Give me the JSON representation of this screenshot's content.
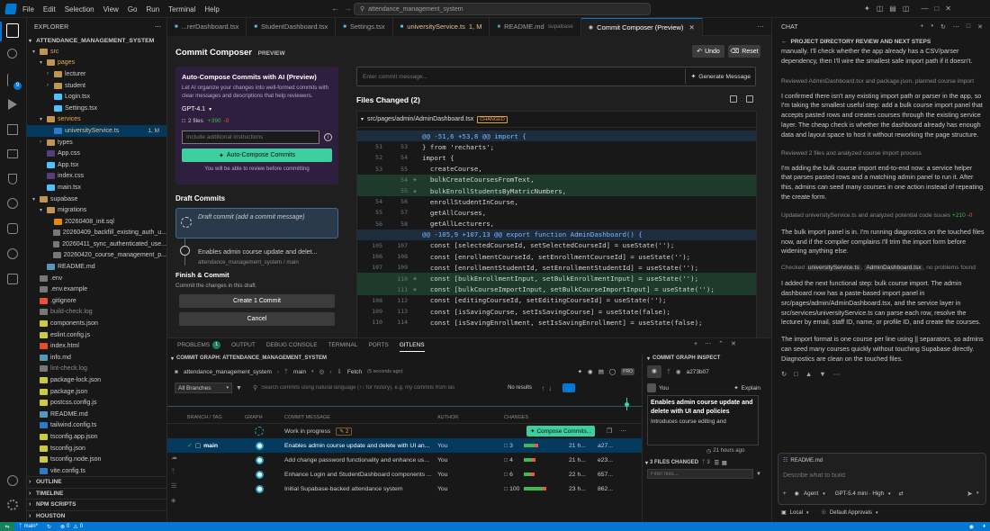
{
  "titlebar": {
    "menus": [
      "File",
      "Edit",
      "Selection",
      "View",
      "Go",
      "Run",
      "Terminal",
      "Help"
    ],
    "search_text": "attendance_management_system"
  },
  "activity": {
    "icons": [
      "files-icon",
      "search-icon",
      "source-control-icon",
      "run-debug-icon",
      "extensions-icon",
      "remote-icon",
      "testing-icon",
      "gitlens-icon",
      "github-icon",
      "timeline-icon",
      "account-icon",
      "settings-icon"
    ],
    "badge": "9"
  },
  "explorer": {
    "header": "EXPLORER",
    "root": "ATTENDANCE_MANAGEMENT_SYSTEM",
    "items": [
      {
        "label": "src",
        "depth": 0,
        "type": "folder-open",
        "color": "#e8ab53"
      },
      {
        "label": "pages",
        "depth": 1,
        "type": "folder-open",
        "color": "#e8ab53"
      },
      {
        "label": "lecturer",
        "depth": 2,
        "type": "folder",
        "color": "#cccccc"
      },
      {
        "label": "student",
        "depth": 2,
        "type": "folder",
        "color": "#cccccc"
      },
      {
        "label": "Login.tsx",
        "depth": 2,
        "type": "file",
        "color": "#cccccc"
      },
      {
        "label": "Settings.tsx",
        "depth": 2,
        "type": "file",
        "color": "#cccccc"
      },
      {
        "label": "services",
        "depth": 1,
        "type": "folder-open",
        "color": "#e8ab53"
      },
      {
        "label": "universityService.ts",
        "depth": 2,
        "type": "file",
        "color": "#e2c08d",
        "badge": "1, M"
      },
      {
        "label": "types",
        "depth": 1,
        "type": "folder",
        "color": "#cccccc"
      },
      {
        "label": "App.css",
        "depth": 1,
        "type": "file",
        "color": "#cccccc"
      },
      {
        "label": "App.tsx",
        "depth": 1,
        "type": "file",
        "color": "#cccccc"
      },
      {
        "label": "index.css",
        "depth": 1,
        "type": "file",
        "color": "#cccccc"
      },
      {
        "label": "main.tsx",
        "depth": 1,
        "type": "file",
        "color": "#cccccc"
      },
      {
        "label": "supabase",
        "depth": 0,
        "type": "folder-open",
        "color": "#cccccc"
      },
      {
        "label": "migrations",
        "depth": 1,
        "type": "folder-open",
        "color": "#cccccc"
      },
      {
        "label": "20260408_init.sql",
        "depth": 2,
        "type": "file",
        "color": "#cccccc"
      },
      {
        "label": "20260409_backfill_existing_auth_u...",
        "depth": 2,
        "type": "file",
        "color": "#cccccc"
      },
      {
        "label": "20260411_sync_authenticated_use...",
        "depth": 2,
        "type": "file",
        "color": "#cccccc"
      },
      {
        "label": "20260420_course_management_p...",
        "depth": 2,
        "type": "file",
        "color": "#cccccc"
      },
      {
        "label": "README.md",
        "depth": 1,
        "type": "file",
        "color": "#cccccc"
      },
      {
        "label": ".env",
        "depth": 0,
        "type": "file",
        "color": "#cccccc"
      },
      {
        "label": ".env.example",
        "depth": 0,
        "type": "file",
        "color": "#cccccc"
      },
      {
        "label": ".gitignore",
        "depth": 0,
        "type": "file",
        "color": "#cccccc"
      },
      {
        "label": "build-check.log",
        "depth": 0,
        "type": "file",
        "color": "#8b8b8b"
      },
      {
        "label": "components.json",
        "depth": 0,
        "type": "file",
        "color": "#cccccc"
      },
      {
        "label": "eslint.config.js",
        "depth": 0,
        "type": "file",
        "color": "#cccccc"
      },
      {
        "label": "index.html",
        "depth": 0,
        "type": "file",
        "color": "#cccccc"
      },
      {
        "label": "info.md",
        "depth": 0,
        "type": "file",
        "color": "#cccccc"
      },
      {
        "label": "lint-check.log",
        "depth": 0,
        "type": "file",
        "color": "#8b8b8b"
      },
      {
        "label": "package-lock.json",
        "depth": 0,
        "type": "file",
        "color": "#cccccc"
      },
      {
        "label": "package.json",
        "depth": 0,
        "type": "file",
        "color": "#cccccc"
      },
      {
        "label": "postcss.config.js",
        "depth": 0,
        "type": "file",
        "color": "#cccccc"
      },
      {
        "label": "README.md",
        "depth": 0,
        "type": "file",
        "color": "#cccccc"
      },
      {
        "label": "tailwind.config.ts",
        "depth": 0,
        "type": "file",
        "color": "#cccccc"
      },
      {
        "label": "tsconfig.app.json",
        "depth": 0,
        "type": "file",
        "color": "#cccccc"
      },
      {
        "label": "tsconfig.json",
        "depth": 0,
        "type": "file",
        "color": "#cccccc"
      },
      {
        "label": "tsconfig.node.json",
        "depth": 0,
        "type": "file",
        "color": "#cccccc"
      },
      {
        "label": "vite.config.ts",
        "depth": 0,
        "type": "file",
        "color": "#cccccc"
      }
    ],
    "sections": [
      "OUTLINE",
      "TIMELINE",
      "NPM SCRIPTS",
      "HOUSTON"
    ]
  },
  "tabs": [
    {
      "label": "...rerDashboard.tsx",
      "active": false
    },
    {
      "label": "StudentDashboard.tsx",
      "active": false
    },
    {
      "label": "Settings.tsx",
      "active": false
    },
    {
      "label": "universityService.ts",
      "active": false,
      "badge": "1, M"
    },
    {
      "label": "README.md",
      "active": false,
      "suffix": "supabase"
    },
    {
      "label": "Commit Composer (Preview)",
      "active": true
    }
  ],
  "composer": {
    "title": "Commit Composer",
    "preview": "PREVIEW",
    "undo": "Undo",
    "reset": "Reset",
    "ai_title": "Auto-Compose Commits with AI (Preview)",
    "ai_desc": "Let AI organize your changes into well-formed commits with clear messages and descriptions that help reviewers.",
    "model": "GPT-4.1",
    "stats": "2 files",
    "added": "+390",
    "removed": "-0",
    "instructions_placeholder": "Include additional instructions",
    "auto_button": "Auto-Compose Commits",
    "review_note": "You will be able to review before committing",
    "draft_title": "Draft Commits",
    "draft_commit": "Draft commit (add a commit message)",
    "commit2_title": "Enables admin course update and delet...",
    "commit2_sub": "attendance_management_system / main",
    "finish_title": "Finish & Commit",
    "finish_desc": "Commit the changes in this draft.",
    "create_button": "Create 1 Commit",
    "cancel_button": "Cancel",
    "message_placeholder": "Enter commit message...",
    "generate_button": "Generate Message",
    "files_changed": "Files Changed (2)",
    "file_path": "src/pages/admin/AdminDashboard.tsx",
    "file_status": "CHANGED"
  },
  "diff": [
    {
      "type": "hunk",
      "old": "",
      "new": "",
      "text": "@@ -51,6 +53,8 @@ import {"
    },
    {
      "type": "ctx",
      "old": "51",
      "new": "53",
      "text": "} from 'recharts';"
    },
    {
      "type": "ctx",
      "old": "52",
      "new": "54",
      "text": "import {"
    },
    {
      "type": "ctx",
      "old": "53",
      "new": "55",
      "text": "  createCourse,"
    },
    {
      "type": "add",
      "old": "",
      "new": "54",
      "text": "  bulkCreateCoursesFromText,"
    },
    {
      "type": "add",
      "old": "",
      "new": "55",
      "text": "  bulkEnrollStudentsByMatricNumbers,"
    },
    {
      "type": "ctx",
      "old": "54",
      "new": "56",
      "text": "  enrollStudentInCourse,"
    },
    {
      "type": "ctx",
      "old": "55",
      "new": "57",
      "text": "  getAllCourses,"
    },
    {
      "type": "ctx",
      "old": "56",
      "new": "58",
      "text": "  getAllLecturers,"
    },
    {
      "type": "hunk",
      "old": "",
      "new": "",
      "text": "@@ -105,9 +107,13 @@ export function AdminDashboard() {"
    },
    {
      "type": "ctx",
      "old": "105",
      "new": "107",
      "text": "  const [selectedCourseId, setSelectedCourseId] = useState('');"
    },
    {
      "type": "ctx",
      "old": "106",
      "new": "108",
      "text": "  const [enrollmentCourseId, setEnrollmentCourseId] = useState('');"
    },
    {
      "type": "ctx",
      "old": "107",
      "new": "109",
      "text": "  const [enrollmentStudentId, setEnrollmentStudentId] = useState('');"
    },
    {
      "type": "add",
      "old": "",
      "new": "110",
      "text": "  const [bulkEnrollmentInput, setBulkEnrollmentInput] = useState('');"
    },
    {
      "type": "add",
      "old": "",
      "new": "111",
      "text": "  const [bulkCourseImportInput, setBulkCourseImportInput] = useState('');"
    },
    {
      "type": "ctx",
      "old": "108",
      "new": "112",
      "text": "  const [editingCourseId, setEditingCourseId] = useState('');"
    },
    {
      "type": "ctx",
      "old": "109",
      "new": "113",
      "text": "  const [isSavingCourse, setIsSavingCourse] = useState(false);"
    },
    {
      "type": "ctx",
      "old": "110",
      "new": "114",
      "text": "  const [isSavingEnrollment, setIsSavingEnrollment] = useState(false);"
    }
  ],
  "panel": {
    "tabs": [
      {
        "label": "PROBLEMS",
        "badge": "1"
      },
      {
        "label": "OUTPUT"
      },
      {
        "label": "DEBUG CONSOLE"
      },
      {
        "label": "TERMINAL"
      },
      {
        "label": "PORTS"
      },
      {
        "label": "GITLENS",
        "active": true
      }
    ],
    "graph_title": "COMMIT GRAPH: ATTENDANCE_MANAGEMENT_SYSTEM",
    "repo": "attendance_management_system",
    "branch": "main",
    "fetch": "Fetch",
    "fetch_time": "(5 seconds ago)",
    "all_branches": "All Branches",
    "search_placeholder": "Search commits using natural language (↑↓ for history), e.g. my commits from las",
    "no_results": "No results",
    "columns": [
      "BRANCH / TAG",
      "GRAPH",
      "COMMIT MESSAGE",
      "AUTHOR",
      "CHANGES",
      "",
      ""
    ],
    "wip_label": "Work in progress",
    "wip_count": "2",
    "compose_button": "Compose Commits...",
    "commits": [
      {
        "branch": "main",
        "message": "Enables admin course update and delete with UI an...",
        "author": "You",
        "files": "3",
        "time": "21 h...",
        "sha": "a27...",
        "selected": true,
        "bar": 40
      },
      {
        "message": "Add change password functionality and enhance us...",
        "author": "You",
        "files": "4",
        "time": "21 h...",
        "sha": "e23...",
        "bar": 30
      },
      {
        "message": "Enhance Login and StudentDashboard components ...",
        "author": "You",
        "files": "6",
        "time": "22 h...",
        "sha": "657...",
        "bar": 28
      },
      {
        "message": "Initial Supabase-backed attendance system",
        "author": "You",
        "files": "100",
        "time": "23 h...",
        "sha": "862...",
        "bar": 70
      }
    ]
  },
  "inspect": {
    "title": "COMMIT GRAPH INSPECT",
    "sha": "a273b07",
    "author": "You",
    "explain": "Explain",
    "commit_title": "Enables admin course update and delete with UI and policies",
    "commit_body": "Introduces course editing and",
    "time": "21 hours ago",
    "files_changed": "3 FILES CHANGED",
    "files_count": "3",
    "filter_placeholder": "Filter files..."
  },
  "chat": {
    "header": "CHAT",
    "title": "PROJECT DIRECTORY REVIEW AND NEXT STEPS",
    "p1": "manually. I'll check whether the app already has a CSV/parser dependency, then I'll wire the smallest safe import path if it doesn't.",
    "m1": "Reviewed AdminDashboard.tsx and package.json, planned course import",
    "p2": "I confirmed there isn't any existing import path or parser in the app, so I'm taking the smallest useful step: add a bulk course import panel that accepts pasted rows and creates courses through the existing service layer. The cheap check is whether the dashboard already has enough data and layout space to host it without reworking the page structure.",
    "m2": "Reviewed 2 files and analyzed course import process",
    "p3": "I'm adding the bulk course import end-to-end now: a service helper that parses pasted rows and a matching admin panel to run it. After this, admins can seed many courses in one action instead of repeating the create form.",
    "m3": "Updated universityService.ts and analyzed potential code issues",
    "m3_add": "+210",
    "m3_del": "-0",
    "p4": "The bulk import panel is in. I'm running diagnostics on the touched files now, and if the compiler complains I'll trim the import form before widening anything else.",
    "checked": "Checked",
    "checked_f1": "universityService.ts",
    "checked_f2": "AdminDashboard.tsx",
    "checked_tail": ", no problems found",
    "p5": "I added the next functional step: bulk course import. The admin dashboard now has a paste-based import panel in src/pages/admin/AdminDashboard.tsx, and the service layer in src/services/universityService.ts can parse each row, resolve the lecturer by email, staff ID, name, or profile ID, and create the courses.",
    "p6": "The import format is one course per line using || separators, so admins can seed many courses quickly without touching Supabase directly. Diagnostics are clean on the touched files.",
    "context_file": "README.md",
    "input_placeholder": "Describe what to build",
    "agent": "Agent",
    "model": "GPT-5.4 mini · High",
    "local": "Local",
    "approvals": "Default Approvals"
  },
  "status": {
    "branch": "main*",
    "sync": "↻",
    "errors": "0",
    "warnings": "0"
  }
}
